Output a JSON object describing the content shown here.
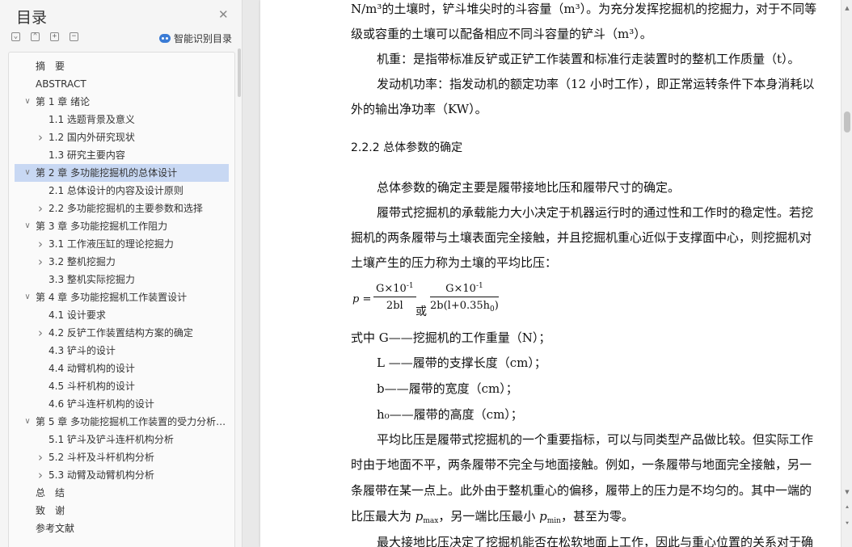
{
  "sidebar": {
    "title": "目录",
    "ai_toc_label": "智能识别目录",
    "tools": [
      "expand-all",
      "collapse-all",
      "add-heading",
      "remove-heading"
    ],
    "toc": [
      {
        "label": "摘　要",
        "level": 1,
        "chevron": "none"
      },
      {
        "label": "ABSTRACT",
        "level": 1,
        "chevron": "none"
      },
      {
        "label": "第 1 章  绪论",
        "level": 1,
        "chevron": "down"
      },
      {
        "label": "1.1  选题背景及意义",
        "level": 2,
        "chevron": "none"
      },
      {
        "label": "1.2  国内外研究现状",
        "level": 2,
        "chevron": "right"
      },
      {
        "label": "1.3  研究主要内容",
        "level": 2,
        "chevron": "none"
      },
      {
        "label": "第 2 章  多功能挖掘机的总体设计",
        "level": 1,
        "chevron": "down",
        "selected": true
      },
      {
        "label": "2.1  总体设计的内容及设计原则",
        "level": 2,
        "chevron": "none"
      },
      {
        "label": "2.2  多功能挖掘机的主要参数和选择",
        "level": 2,
        "chevron": "right"
      },
      {
        "label": "第 3 章  多功能挖掘机工作阻力",
        "level": 1,
        "chevron": "down"
      },
      {
        "label": "3.1  工作液压缸的理论挖掘力",
        "level": 2,
        "chevron": "right"
      },
      {
        "label": "3.2  整机挖掘力",
        "level": 2,
        "chevron": "right"
      },
      {
        "label": "3.3  整机实际挖掘力",
        "level": 2,
        "chevron": "none"
      },
      {
        "label": "第 4 章  多功能挖掘机工作装置设计",
        "level": 1,
        "chevron": "down"
      },
      {
        "label": "4.1 设计要求",
        "level": 2,
        "chevron": "none"
      },
      {
        "label": "4.2 反铲工作装置结构方案的确定",
        "level": 2,
        "chevron": "right"
      },
      {
        "label": "4.3  铲斗的设计",
        "level": 2,
        "chevron": "none"
      },
      {
        "label": "4.4 动臂机构的设计",
        "level": 2,
        "chevron": "none"
      },
      {
        "label": "4.5 斗杆机构的设计",
        "level": 2,
        "chevron": "none"
      },
      {
        "label": "4.6  铲斗连杆机构的设计",
        "level": 2,
        "chevron": "none"
      },
      {
        "label": "第 5 章  多功能挖掘机工作装置的受力分析 ...",
        "level": 1,
        "chevron": "down"
      },
      {
        "label": "5.1 铲斗及铲斗连杆机构分析",
        "level": 2,
        "chevron": "none"
      },
      {
        "label": "5.2 斗杆及斗杆机构分析",
        "level": 2,
        "chevron": "right"
      },
      {
        "label": "5.3 动臂及动臂机构分析",
        "level": 2,
        "chevron": "right"
      },
      {
        "label": "总　结",
        "level": 1,
        "chevron": "none"
      },
      {
        "label": "致　谢",
        "level": 1,
        "chevron": "none"
      },
      {
        "label": "参考文献",
        "level": 1,
        "chevron": "none"
      }
    ]
  },
  "document": {
    "lines": [
      {
        "text": "N/m³的土壤时，铲斗堆尖时的斗容量（m³）。为充分发挥挖掘机的挖掘力，对于不同等",
        "indent": false
      },
      {
        "text": "级或容重的土壤可以配备相应不同斗容量的铲斗（m³）。",
        "indent": false
      },
      {
        "text": "机重：是指带标准反铲或正铲工作装置和标准行走装置时的整机工作质量（t）。",
        "indent": true
      },
      {
        "text": "发动机功率：指发动机的额定功率（12 小时工作），即正常运转条件下本身消耗以",
        "indent": true
      },
      {
        "text": "外的输出净功率（KW）。",
        "indent": false
      },
      {
        "text": "2.2.2  总体参数的确定",
        "indent": false,
        "heading": true
      },
      {
        "text": "总体参数的确定主要是履带接地比压和履带尺寸的确定。",
        "indent": true
      },
      {
        "text": "履带式挖掘机的承载能力大小决定于机器运行时的通过性和工作时的稳定性。若挖",
        "indent": true
      },
      {
        "text": "掘机的两条履带与土壤表面完全接触，并且挖掘机重心近似于支撑面中心，则挖掘机对",
        "indent": false
      },
      {
        "text": "土壤产生的压力称为土壤的平均比压：",
        "indent": false
      },
      {
        "text": "式中 G——挖掘机的工作重量（N）；",
        "indent": false
      },
      {
        "text": "L ——履带的支撑长度（cm）；",
        "indent": true
      },
      {
        "text": "b——履带的宽度（cm）；",
        "indent": true
      },
      {
        "text": "h₀——履带的高度（cm）；",
        "indent": true
      },
      {
        "text": "平均比压是履带式挖掘机的一个重要指标，可以与同类型产品做比较。但实际工作",
        "indent": true
      },
      {
        "text": "时由于地面不平，两条履带不完全与地面接触。例如，一条履带与地面完全接触，另一",
        "indent": false
      },
      {
        "text": "条履带在某一点上。此外由于整机重心的偏移，履带上的压力是不均匀的。其中一端的",
        "indent": false
      },
      {
        "text": "比压最大为",
        "indent": false
      },
      {
        "text": "最大接地比压决定了挖掘机能否在松软地面上工作，因此与重心位置的关系对于确",
        "indent": true
      }
    ],
    "formula": {
      "lhs": "p =",
      "num1": "G×10",
      "exp": "-1",
      "den1": "2bl",
      "or": "或",
      "num2": "G×10",
      "den2": "2b(l+0.35h",
      "den2_sub": "0",
      "den2_end": ")"
    },
    "pmax_line": {
      "before": "比压最大为 ",
      "p": "p",
      "max_sub": "max",
      "middle": "，另一端比压最小 ",
      "min_sub": "min",
      "after": "，甚至为零。"
    }
  }
}
